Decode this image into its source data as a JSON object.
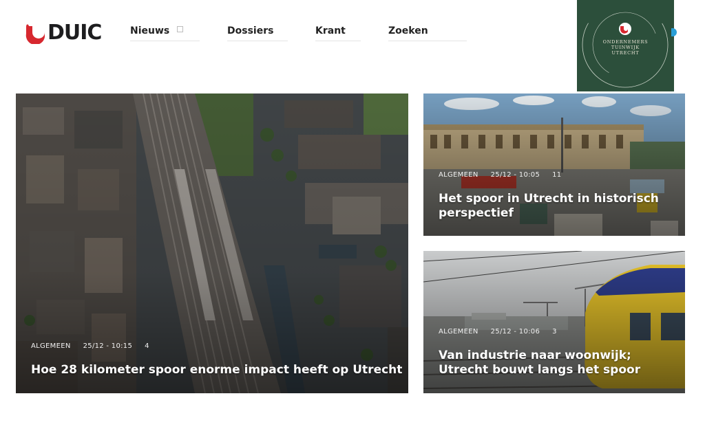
{
  "header": {
    "logo_text": "DUIC",
    "nav": [
      {
        "label": "Nieuws"
      },
      {
        "label": "Dossiers"
      },
      {
        "label": "Krant"
      },
      {
        "label": "Zoeken"
      }
    ],
    "promo": {
      "lines": [
        "ONDERNEMERS",
        "TUINWIJK",
        "UTRECHT"
      ],
      "background": "#2c4f3b"
    }
  },
  "articles": [
    {
      "category": "ALGEMEEN",
      "time": "25/12 - 10:15",
      "comments": "4",
      "title": "Hoe 28 kilometer spoor enorme impact heeft op Utrecht"
    },
    {
      "category": "ALGEMEEN",
      "time": "25/12 - 10:05",
      "comments": "11",
      "title": "Het spoor in Utrecht in historisch perspectief"
    },
    {
      "category": "ALGEMEEN",
      "time": "25/12 - 10:06",
      "comments": "3",
      "title": "Van industrie naar woonwijk; Utrecht bouwt langs het spoor"
    }
  ],
  "colors": {
    "brand_red": "#d7282f",
    "brand_dark": "#1d1d1f",
    "accent_blue": "#2a9fd6"
  }
}
